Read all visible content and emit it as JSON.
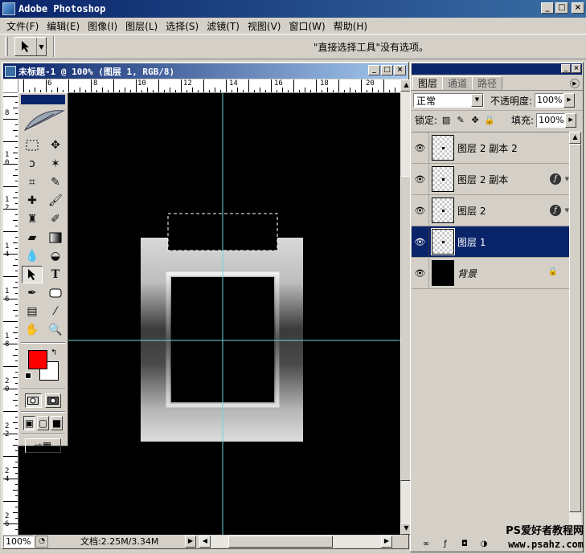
{
  "app": {
    "title": "Adobe Photoshop",
    "window_buttons": [
      "_",
      "□",
      "×"
    ]
  },
  "menu": [
    {
      "label": "文件(F)"
    },
    {
      "label": "编辑(E)"
    },
    {
      "label": "图像(I)"
    },
    {
      "label": "图层(L)"
    },
    {
      "label": "选择(S)"
    },
    {
      "label": "滤镜(T)"
    },
    {
      "label": "视图(V)"
    },
    {
      "label": "窗口(W)"
    },
    {
      "label": "帮助(H)"
    }
  ],
  "options_bar": {
    "message": "\"直接选择工具\"没有选项。"
  },
  "document": {
    "title": "未标题-1 @ 100% (图层 1, RGB/8)",
    "ruler_h_labels": [
      "6",
      "8",
      "10",
      "12",
      "14",
      "16",
      "18",
      "20"
    ],
    "ruler_v_labels": [
      "8",
      "1 0",
      "1 2",
      "1 4",
      "1 6",
      "1 8",
      "2 0",
      "2 2",
      "2 4",
      "2 6"
    ],
    "zoom": "100%",
    "doc_size": "文档:2.25M/3.34M"
  },
  "colors": {
    "foreground": "#ff0000",
    "background": "#ffffff",
    "guide": "#6fd6e0",
    "selection_bg": "#0a246a"
  },
  "layers_panel": {
    "tabs": [
      "图层",
      "通道",
      "路径"
    ],
    "blend_mode": "正常",
    "opacity_label": "不透明度:",
    "opacity": "100%",
    "lock_label": "锁定:",
    "fill_label": "填充:",
    "fill": "100%",
    "layers": [
      {
        "name": "图层 2 副本 2",
        "selected": false,
        "fx": false,
        "locked": false
      },
      {
        "name": "图层 2 副本",
        "selected": false,
        "fx": true,
        "locked": false
      },
      {
        "name": "图层 2",
        "selected": false,
        "fx": true,
        "locked": false
      },
      {
        "name": "图层 1",
        "selected": true,
        "fx": false,
        "locked": false
      },
      {
        "name": "背景",
        "selected": false,
        "fx": false,
        "locked": true
      }
    ]
  },
  "watermark": {
    "line1": "PS爱好者教程网",
    "line2": "www.psahz.com"
  }
}
